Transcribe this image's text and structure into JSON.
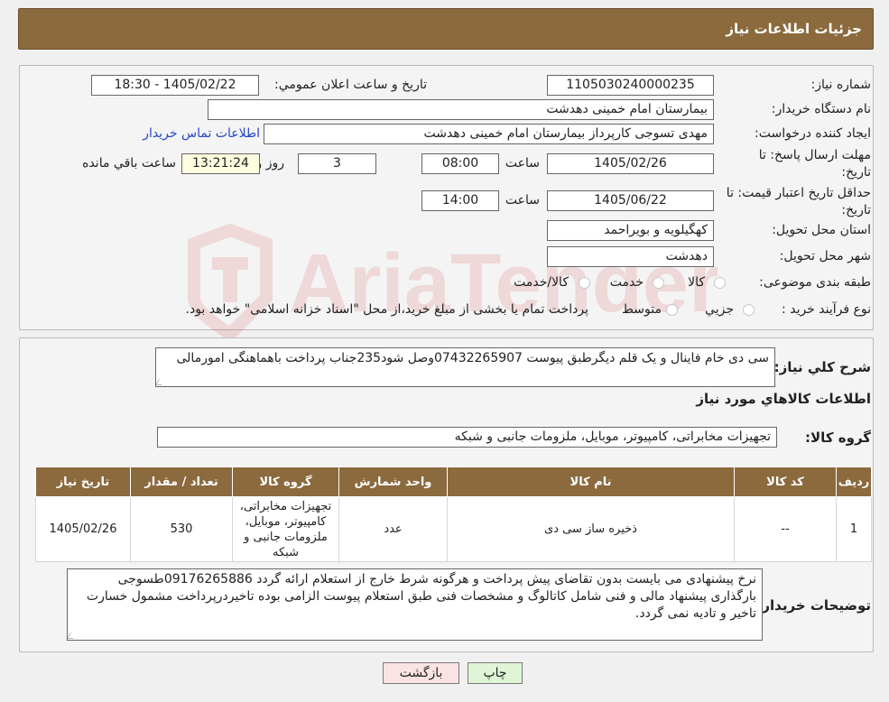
{
  "header": {
    "title": "جزئیات اطلاعات نیاز"
  },
  "labels": {
    "need_number": "شماره نیاز:",
    "announce_datetime": "تاریخ و ساعت اعلان عمومي:",
    "buyer_org": "نام دستگاه خریدار:",
    "requester": "ایجاد کننده درخواست:",
    "contact_link": "اطلاعات تماس خریدار",
    "reply_deadline": "مهلت ارسال پاسخ: تا تاریخ:",
    "price_validity": "حداقل تاریخ اعتبار قیمت: تا تاریخ:",
    "time": "ساعت",
    "days": "روز و",
    "remaining": "ساعت باقي مانده",
    "delivery_province": "استان محل تحویل:",
    "delivery_city": "شهر محل تحویل:",
    "category": "طبقه بندی موضوعی:",
    "purchase_type": "نوع فرآیند خرید :",
    "general_desc": "شرح کلي نیاز:",
    "goods_info": "اطلاعات کالاهاي مورد نیاز",
    "goods_group": "گروه کالا:",
    "buyer_notes": "توضیحات خریدار:"
  },
  "values": {
    "need_number": "1105030240000235",
    "announce_datetime": "1405/02/22 - 18:30",
    "buyer_org": "بیمارستان امام خمینی دهدشت",
    "requester": "مهدی تسوجی کارپرداز بیمارستان امام خمینی دهدشت",
    "reply_date": "1405/02/26",
    "reply_time": "08:00",
    "reply_days": "3",
    "reply_remaining": "13:21:24",
    "validity_date": "1405/06/22",
    "validity_time": "14:00",
    "delivery_province": "کهگیلویه و بویراحمد",
    "delivery_city": "دهدشت",
    "general_desc": "سی دی خام فاینال و یک قلم دیگرطبق پیوست 07432265907وصل شود235جناب پرداخت باهماهنگی امورمالی",
    "goods_group": "تجهیزات مخابراتی، کامپیوتر، موبایل، ملزومات جانبی و شبکه",
    "buyer_notes": "نرخ پیشنهادی می بایست بدون تقاضای پیش پرداخت و هرگونه شرط خارج از استعلام ارائه گردد 09176265886طسوجی بارگذاری پیشنهاد مالی و فنی شامل کاتالوگ و مشخصات فنی طبق استعلام پیوست الزامی بوده تاخیردرپرداخت مشمول خسارت تاخیر و تادیه نمی گردد."
  },
  "category_options": [
    "کالا",
    "خدمت",
    "کالا/خدمت"
  ],
  "purchase_options": [
    "جزیي",
    "متوسط"
  ],
  "purchase_note": "پرداخت تمام یا بخشی از مبلغ خرید،از محل \"اسناد خزانه اسلامی\" خواهد بود.",
  "table": {
    "headers": [
      "ردیف",
      "کد کالا",
      "نام کالا",
      "واحد شمارش",
      "گروه کالا",
      "تعداد / مقدار",
      "تاریخ نیاز"
    ],
    "rows": [
      [
        "1",
        "--",
        "ذخیره ساز سی دی",
        "عدد",
        "تجهیزات مخابراتی، کامپیوتر، موبایل، ملزومات جانبی و شبکه",
        "530",
        "1405/02/26"
      ]
    ]
  },
  "buttons": {
    "print": "چاپ",
    "back": "بازگشت"
  },
  "watermark": "AriaTender.neT",
  "colors": {
    "header_brown": "#8b6a3e",
    "print_btn": "#dff5d5",
    "back_btn": "#fbe3e3",
    "link": "#2446c9",
    "watermark": "#cc2222"
  }
}
